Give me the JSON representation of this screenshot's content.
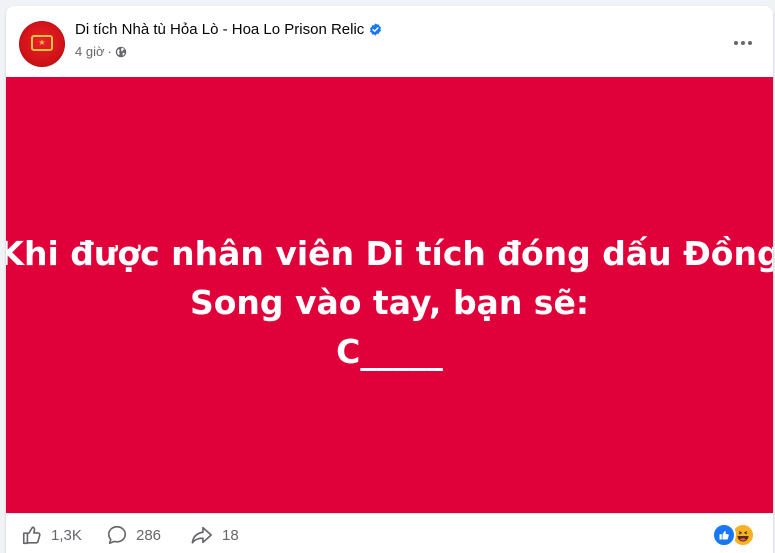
{
  "post": {
    "page_name": "Di tích Nhà tù Hỏa Lò - Hoa Lo Prison Relic",
    "time": "4 giờ",
    "separator": "·",
    "image_text": {
      "line1": "Khi được nhân viên Di tích đóng dấu Đồng",
      "line2": "Song vào tay, bạn sẽ:",
      "line3": "C_____"
    },
    "image_background": "#e0003a"
  },
  "footer": {
    "likes": "1,3K",
    "comments": "286",
    "shares": "18"
  },
  "icons": {
    "verified": "verified-badge-icon",
    "globe": "globe-icon",
    "more": "more-options-icon",
    "like": "thumbs-up-icon",
    "comment": "comment-bubble-icon",
    "share": "share-arrow-icon",
    "reactions": [
      "like-reaction-icon",
      "haha-reaction-icon"
    ]
  },
  "colors": {
    "accent": "#1877f2",
    "muted_text": "#65676b"
  }
}
